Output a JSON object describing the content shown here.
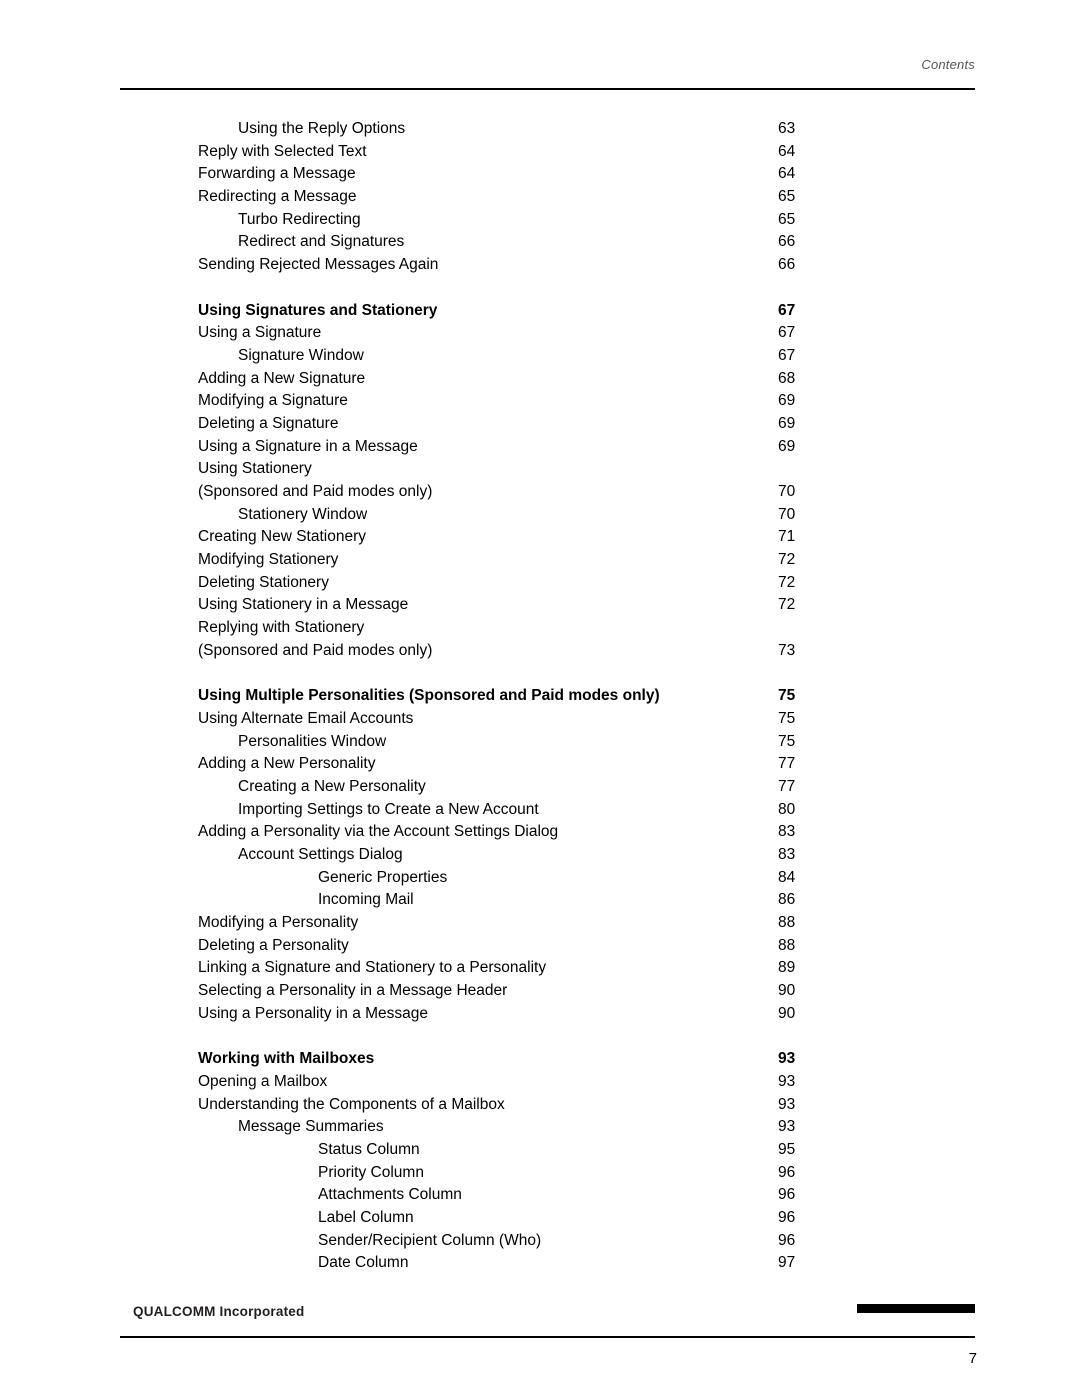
{
  "header": {
    "section_label": "Contents"
  },
  "footer": {
    "company": "QUALCOMM Incorporated",
    "page_number": "7"
  },
  "toc": {
    "entries": [
      {
        "title": "Using the Reply Options",
        "page": "63",
        "level": "lvl0"
      },
      {
        "title": "Reply with Selected Text",
        "page": "64",
        "level": "lvl0b"
      },
      {
        "title": "Forwarding a Message",
        "page": "64",
        "level": "lvl0b"
      },
      {
        "title": "Redirecting a Message",
        "page": "65",
        "level": "lvl0b"
      },
      {
        "title": "Turbo Redirecting",
        "page": "65",
        "level": "lvl1"
      },
      {
        "title": "Redirect and Signatures",
        "page": "66",
        "level": "lvl1"
      },
      {
        "title": "Sending Rejected Messages Again",
        "page": "66",
        "level": "lvl0b"
      },
      {
        "title": "",
        "page": "",
        "level": "spacer"
      },
      {
        "title": "Using Signatures and Stationery",
        "page": "67",
        "level": "lvlH0"
      },
      {
        "title": "Using a Signature",
        "page": "67",
        "level": "lvl0b"
      },
      {
        "title": "Signature Window",
        "page": "67",
        "level": "lvl1"
      },
      {
        "title": "Adding a New Signature",
        "page": "68",
        "level": "lvl0b"
      },
      {
        "title": "Modifying a Signature",
        "page": "69",
        "level": "lvl0b"
      },
      {
        "title": "Deleting a Signature",
        "page": "69",
        "level": "lvl0b"
      },
      {
        "title": "Using a Signature in a Message",
        "page": "69",
        "level": "lvl0b"
      },
      {
        "title": "Using Stationery",
        "page": "",
        "level": "lvl0b"
      },
      {
        "title": "(Sponsored and Paid modes only)",
        "page": "70",
        "level": "lvl0b"
      },
      {
        "title": "Stationery Window",
        "page": "70",
        "level": "lvl1"
      },
      {
        "title": "Creating New Stationery",
        "page": "71",
        "level": "lvl0b"
      },
      {
        "title": "Modifying Stationery",
        "page": "72",
        "level": "lvl0b"
      },
      {
        "title": "Deleting Stationery",
        "page": "72",
        "level": "lvl0b"
      },
      {
        "title": "Using Stationery in a Message",
        "page": "72",
        "level": "lvl0b"
      },
      {
        "title": "Replying with Stationery",
        "page": "",
        "level": "lvl0b"
      },
      {
        "title": "(Sponsored and Paid modes only)",
        "page": "73",
        "level": "lvl0b"
      },
      {
        "title": "",
        "page": "",
        "level": "spacer"
      },
      {
        "title": "Using Multiple Personalities (Sponsored and Paid modes only)",
        "page": "75",
        "level": "lvlH0b"
      },
      {
        "title": "Using Alternate Email Accounts",
        "page": "75",
        "level": "lvl0b"
      },
      {
        "title": "Personalities Window",
        "page": "75",
        "level": "lvl1"
      },
      {
        "title": "Adding a New Personality",
        "page": "77",
        "level": "lvl0b"
      },
      {
        "title": "Creating a New Personality",
        "page": "77",
        "level": "lvl1"
      },
      {
        "title": "Importing Settings to Create a New Account",
        "page": "80",
        "level": "lvl1"
      },
      {
        "title": "Adding a Personality via the Account Settings Dialog",
        "page": "83",
        "level": "lvl0b"
      },
      {
        "title": "Account Settings Dialog",
        "page": "83",
        "level": "lvl1"
      },
      {
        "title": "Generic Properties",
        "page": "84",
        "level": "lvl3"
      },
      {
        "title": "Incoming Mail",
        "page": "86",
        "level": "lvl3"
      },
      {
        "title": " Modifying a Personality",
        "page": "88",
        "level": "lvl0b"
      },
      {
        "title": "Deleting a Personality",
        "page": "88",
        "level": "lvl0b"
      },
      {
        "title": "Linking a Signature and Stationery to a Personality",
        "page": "89",
        "level": "lvl0b"
      },
      {
        "title": "Selecting a Personality in a Message Header",
        "page": "90",
        "level": "lvl0b"
      },
      {
        "title": "Using a Personality in a Message",
        "page": "90",
        "level": "lvl0b"
      },
      {
        "title": "",
        "page": "",
        "level": "spacer"
      },
      {
        "title": "Working with Mailboxes",
        "page": "93",
        "level": "lvlH0b"
      },
      {
        "title": "Opening a Mailbox",
        "page": "93",
        "level": "lvl0b"
      },
      {
        "title": "Understanding the Components of a Mailbox",
        "page": "93",
        "level": "lvl0b"
      },
      {
        "title": "Message Summaries",
        "page": "93",
        "level": "lvl1"
      },
      {
        "title": "Status Column",
        "page": "95",
        "level": "lvl3"
      },
      {
        "title": "Priority Column",
        "page": "96",
        "level": "lvl3"
      },
      {
        "title": "Attachments Column",
        "page": "96",
        "level": "lvl3"
      },
      {
        "title": "Label Column",
        "page": "96",
        "level": "lvl3"
      },
      {
        "title": "Sender/Recipient Column (Who)",
        "page": "96",
        "level": "lvl3"
      },
      {
        "title": "Date Column",
        "page": "97",
        "level": "lvl3"
      }
    ]
  }
}
